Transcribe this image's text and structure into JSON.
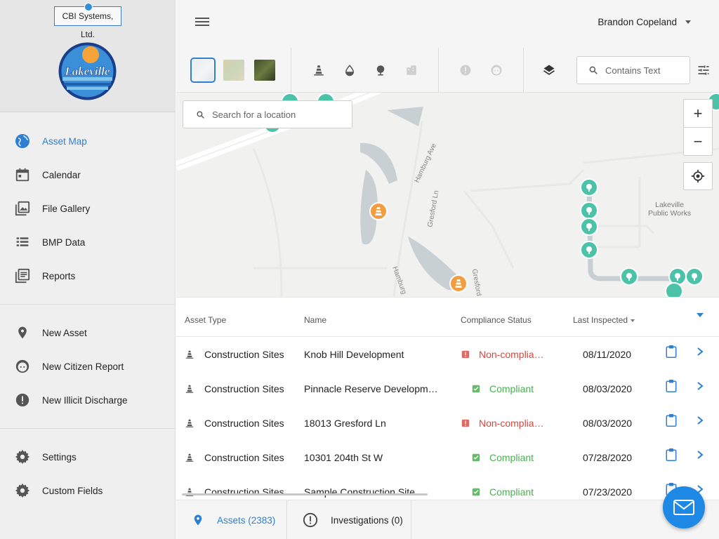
{
  "brand": {
    "company": "CBI Systems, Ltd.",
    "city_logo_text": "Lakeville"
  },
  "sidebar": {
    "primary": [
      {
        "label": "Asset Map",
        "icon": "globe-icon",
        "active": true
      },
      {
        "label": "Calendar",
        "icon": "calendar-icon"
      },
      {
        "label": "File Gallery",
        "icon": "gallery-icon"
      },
      {
        "label": "BMP Data",
        "icon": "list-icon"
      },
      {
        "label": "Reports",
        "icon": "reports-icon"
      }
    ],
    "create": [
      {
        "label": "New Asset",
        "icon": "pin-icon"
      },
      {
        "label": "New Citizen Report",
        "icon": "face-icon"
      },
      {
        "label": "New Illicit Discharge",
        "icon": "alert-icon"
      }
    ],
    "settings": [
      {
        "label": "Settings",
        "icon": "gear-icon"
      },
      {
        "label": "Custom Fields",
        "icon": "gear-icon"
      }
    ]
  },
  "header": {
    "user_name": "Brandon Copeland"
  },
  "toolbar": {
    "search_placeholder": "Contains Text",
    "basemaps": [
      "street-map",
      "terrain-map",
      "satellite-map"
    ]
  },
  "map": {
    "search_placeholder": "Search for a location",
    "streets": [
      "Hamburg Ave",
      "Gresford Ln",
      "Hamburg",
      "Gresford"
    ],
    "poi": [
      "Lakeville",
      "Public Works"
    ],
    "zoom_in": "+",
    "zoom_out": "−",
    "colors": {
      "construction": "#f39c40",
      "bmp": "#4cc3a9"
    }
  },
  "table": {
    "columns": [
      "Asset Type",
      "Name",
      "Compliance Status",
      "Last Inspected"
    ],
    "rows": [
      {
        "type": "Construction Sites",
        "name": "Knob Hill Development",
        "status": "Non-complia…",
        "status_kind": "bad",
        "date": "08/11/2020"
      },
      {
        "type": "Construction Sites",
        "name": "Pinnacle Reserve Developm…",
        "status": "Compliant",
        "status_kind": "good",
        "date": "08/03/2020"
      },
      {
        "type": "Construction Sites",
        "name": "18013 Gresford Ln",
        "status": "Non-complia…",
        "status_kind": "bad",
        "date": "08/03/2020"
      },
      {
        "type": "Construction Sites",
        "name": "10301 204th St W",
        "status": "Compliant",
        "status_kind": "good",
        "date": "07/28/2020"
      },
      {
        "type": "Construction Sites",
        "name": "Sample Construction Site",
        "status": "Compliant",
        "status_kind": "good",
        "date": "07/23/2020"
      }
    ]
  },
  "bottom_tabs": {
    "assets": "Assets (2383)",
    "investigations": "Investigations (0)"
  },
  "theme": {
    "accent": "#2f7fd0",
    "error": "#d9453e",
    "success": "#4caf50",
    "fab": "#1e88e5"
  }
}
